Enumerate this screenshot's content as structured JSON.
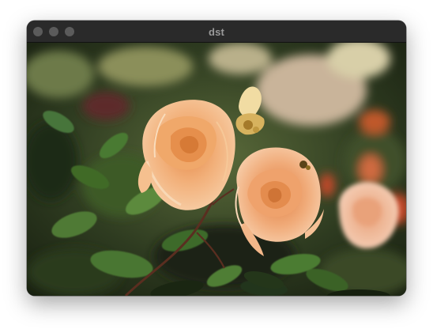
{
  "window": {
    "title": "dst"
  },
  "image": {
    "description_icon": "rose-photo"
  },
  "colors": {
    "titlebar": "#2a2a2a",
    "title_text": "#9a9a9a",
    "traffic_light": "#5b5b5b"
  }
}
